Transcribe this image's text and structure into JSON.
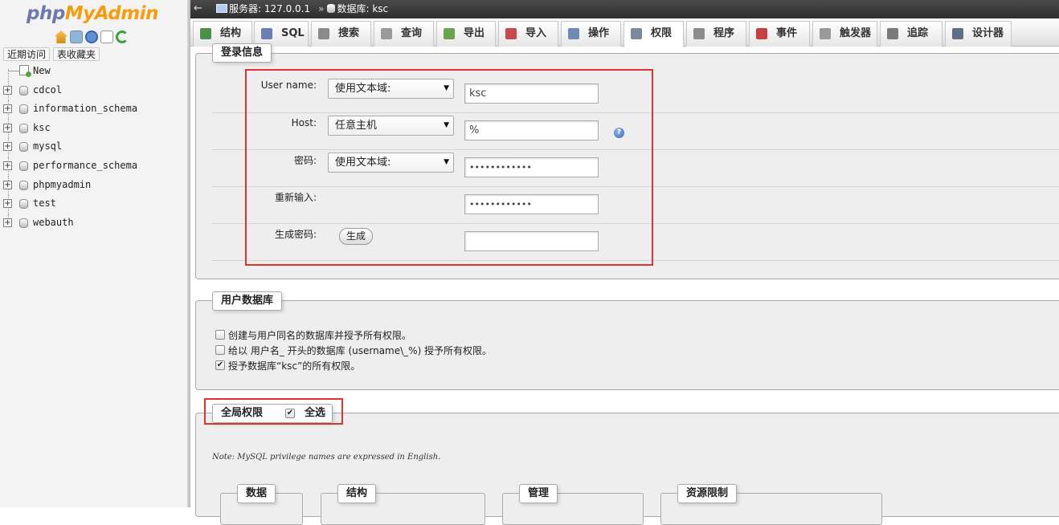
{
  "sidebar": {
    "logo_part1": "php",
    "logo_part2": "MyAdmin",
    "tab_recent": "近期访问",
    "tab_favorites": "表收藏夹",
    "tree_new": "New",
    "databases": [
      "cdcol",
      "information_schema",
      "ksc",
      "mysql",
      "performance_schema",
      "phpmyadmin",
      "test",
      "webauth"
    ]
  },
  "topbar": {
    "back": "←",
    "server": "服务器: 127.0.0.1",
    "separator": "»",
    "database": "数据库: ksc"
  },
  "tabs": [
    {
      "label": "结构",
      "icon": "structure-icon",
      "color": "#4a8f4a"
    },
    {
      "label": "SQL",
      "icon": "sql-icon",
      "color": "#6a7fb4"
    },
    {
      "label": "搜索",
      "icon": "search-icon",
      "color": "#8a8a8a"
    },
    {
      "label": "查询",
      "icon": "query-icon",
      "color": "#9a9a9a"
    },
    {
      "label": "导出",
      "icon": "export-icon",
      "color": "#6aa34f"
    },
    {
      "label": "导入",
      "icon": "import-icon",
      "color": "#c94a4a"
    },
    {
      "label": "操作",
      "icon": "wrench-icon",
      "color": "#6f8ab0"
    },
    {
      "label": "权限",
      "icon": "privileges-icon",
      "color": "#7c8a9e"
    },
    {
      "label": "程序",
      "icon": "routines-icon",
      "color": "#8c8c8c"
    },
    {
      "label": "事件",
      "icon": "clock-icon",
      "color": "#c84040"
    },
    {
      "label": "触发器",
      "icon": "triggers-icon",
      "color": "#9a9a9a"
    },
    {
      "label": "追踪",
      "icon": "eye-icon",
      "color": "#7a7a7a"
    },
    {
      "label": "设计器",
      "icon": "designer-icon",
      "color": "#5f6f84"
    }
  ],
  "login": {
    "legend": "登录信息",
    "username_label": "User name:",
    "username_select": "使用文本域:",
    "username_value": "ksc",
    "host_label": "Host:",
    "host_select": "任意主机",
    "host_value": "%",
    "help": "?",
    "password_label": "密码:",
    "password_select": "使用文本域:",
    "password_value": "••••••••••••",
    "retype_label": "重新输入:",
    "retype_value": "••••••••••••",
    "generate_label": "生成密码:",
    "generate_button": "生成",
    "generated_value": ""
  },
  "userdb": {
    "legend": "用户数据库",
    "option1": "创建与用户同名的数据库并授予所有权限。",
    "option1_checked": false,
    "option2": "给以 用户名_ 开头的数据库 (username\\_%) 授予所有权限。",
    "option2_checked": false,
    "option3": "授予数据库“ksc”的所有权限。",
    "option3_checked": true
  },
  "global": {
    "legend": "全局权限",
    "select_all": "全选",
    "select_all_checked": true,
    "note": "Note: MySQL privilege names are expressed in English.",
    "groups": [
      "数据",
      "结构",
      "管理",
      "资源限制"
    ]
  },
  "colors": {
    "highlight": "#e0322f",
    "topbar": "#3a3a3a",
    "logo_php": "#6c78af",
    "logo_myadmin": "#f89c0e"
  }
}
